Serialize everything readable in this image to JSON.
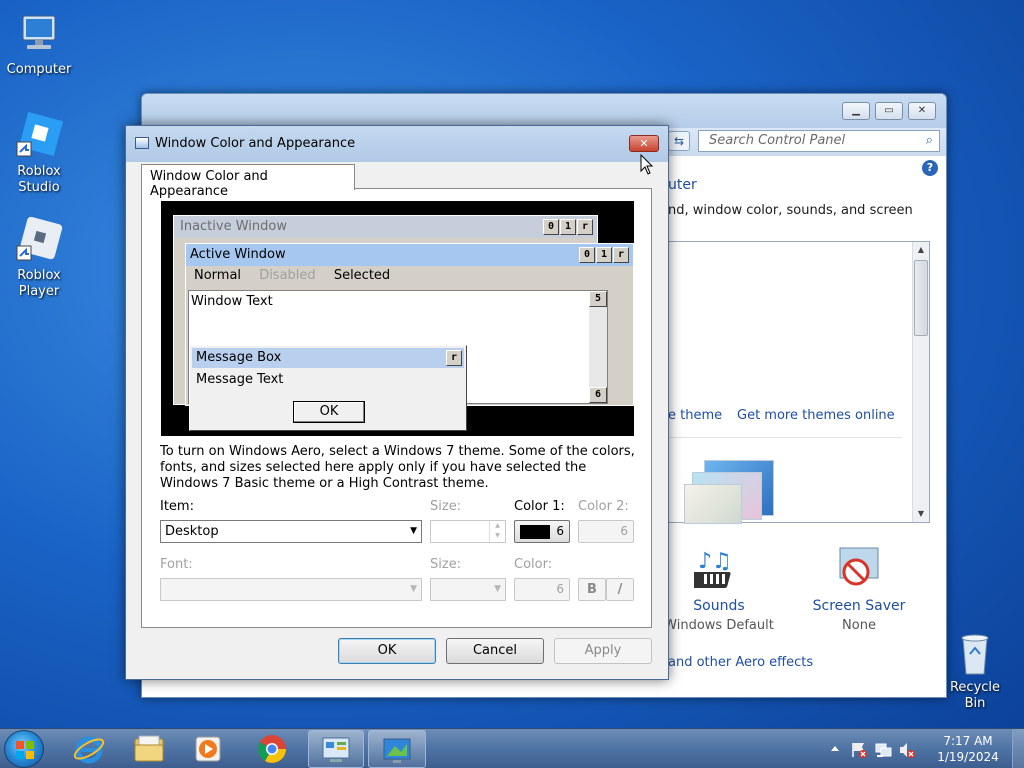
{
  "desktop": {
    "icons": [
      {
        "label": "Computer"
      },
      {
        "label": "Roblox\nStudio"
      },
      {
        "label": "Roblox\nPlayer"
      },
      {
        "label": "Recycle\nBin"
      }
    ]
  },
  "control_panel": {
    "search_placeholder": "Search Control Panel",
    "heading_fragment": "uter",
    "desc_fragment": "nd, window color, sounds, and screen",
    "link_theme": "e theme",
    "link_more_themes": "Get more themes online",
    "sounds_label": "Sounds",
    "sounds_value": "Windows Default",
    "saver_label": "Screen Saver",
    "saver_value": "None",
    "aero_link": "and other Aero effects"
  },
  "dialog": {
    "title": "Window Color and Appearance",
    "tab_label": "Window Color and Appearance",
    "preview": {
      "inactive_title": "Inactive Window",
      "active_title": "Active Window",
      "menu_normal": "Normal",
      "menu_disabled": "Disabled",
      "menu_selected": "Selected",
      "window_text": "Window Text",
      "msgbox_title": "Message Box",
      "msgbox_text": "Message Text",
      "msgbox_ok": "OK"
    },
    "info_text": "To turn on Windows Aero, select a Windows 7 theme.  Some of the colors, fonts, and sizes selected here apply only if you have selected the Windows 7 Basic theme or a High Contrast theme.",
    "item_label": "Item:",
    "item_value": "Desktop",
    "size_label": "Size:",
    "color1_label": "Color 1:",
    "color1_value": "6",
    "color2_label": "Color 2:",
    "color2_value": "6",
    "font_label": "Font:",
    "font_size_label": "Size:",
    "font_color_label": "Color:",
    "font_color_value": "6",
    "bold_label": "B",
    "italic_label": "/",
    "ok": "OK",
    "cancel": "Cancel",
    "apply": "Apply"
  },
  "taskbar": {
    "time": "7:17 AM",
    "date": "1/19/2024"
  },
  "colors": {
    "accent": "#1e4fa0",
    "active_caption": "#a6c8f0",
    "desktop": "#1a64c7"
  }
}
